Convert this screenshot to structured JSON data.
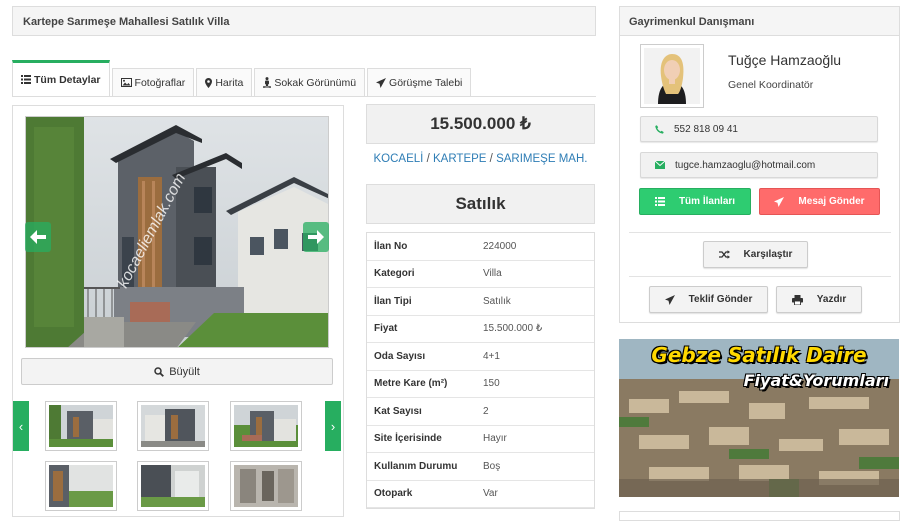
{
  "listing": {
    "title": "Kartepe Sarımeşe Mahallesi Satılık Villa",
    "price": "15.500.000 ₺",
    "location": {
      "city": "KOCAELİ",
      "district": "KARTEPE",
      "neighborhood": "SARIMEŞE MAH.",
      "separator": "/"
    },
    "status": "Satılık"
  },
  "tabs": [
    {
      "label": "Tüm Detaylar",
      "icon": "list-icon",
      "active": true
    },
    {
      "label": "Fotoğraflar",
      "icon": "image-icon"
    },
    {
      "label": "Harita",
      "icon": "map-marker-icon"
    },
    {
      "label": "Sokak Görünümü",
      "icon": "street-view-icon"
    },
    {
      "label": "Görüşme Talebi",
      "icon": "send-icon"
    }
  ],
  "gallery": {
    "watermark": "kocaeliemlak.com",
    "enlarge_label": "Büyült",
    "prev_symbol": "‹",
    "next_symbol": "›"
  },
  "details": [
    {
      "key": "İlan No",
      "value": "224000"
    },
    {
      "key": "Kategori",
      "value": "Villa"
    },
    {
      "key": "İlan Tipi",
      "value": "Satılık"
    },
    {
      "key": "Fiyat",
      "value": "15.500.000 ₺"
    },
    {
      "key": "Oda Sayısı",
      "value": "4+1"
    },
    {
      "key": "Metre Kare (m²)",
      "value": "150"
    },
    {
      "key": "Kat Sayısı",
      "value": "2"
    },
    {
      "key": "Site İçerisinde",
      "value": "Hayır"
    },
    {
      "key": "Kullanım Durumu",
      "value": "Boş"
    },
    {
      "key": "Otopark",
      "value": "Var"
    }
  ],
  "advisor": {
    "header": "Gayrimenkul Danışmanı",
    "name": "Tuğçe Hamzaoğlu",
    "role": "Genel Koordinatör",
    "phone": "552 818 09 41",
    "email": "tugce.hamzaoglu@hotmail.com",
    "all_listings_label": "Tüm İlanları",
    "send_message_label": "Mesaj Gönder",
    "compare_label": "Karşılaştır",
    "send_offer_label": "Teklif Gönder",
    "print_label": "Yazdır"
  },
  "ad": {
    "line1": "Gebze Satılık Daire",
    "line2": "Fiyat&Yorumları"
  },
  "colors": {
    "accent_green": "#27ae60",
    "link_blue": "#2e7db5",
    "button_red": "#ff6b6b"
  }
}
